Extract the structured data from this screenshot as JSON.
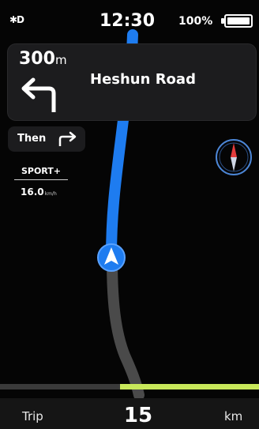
{
  "status": {
    "bluetooth_icon": "bluetooth-icon",
    "time": "12:30",
    "battery": "100%"
  },
  "navigation": {
    "distance": "300",
    "distance_unit": "m",
    "maneuver_icon": "turn-left-icon",
    "street": "Heshun Road",
    "then_label": "Then",
    "then_icon": "turn-right-icon"
  },
  "ride": {
    "mode": "SPORT+",
    "speed": "16.0",
    "speed_unit": "km/h"
  },
  "map": {
    "route_color": "#1e7cf0",
    "traveled_color": "#4a4a4a",
    "progress_color": "#c8e85a",
    "position_icon": "location-arrow-icon",
    "compass_icon": "compass-icon"
  },
  "trip": {
    "label": "Trip",
    "value": "15",
    "unit": "km"
  }
}
